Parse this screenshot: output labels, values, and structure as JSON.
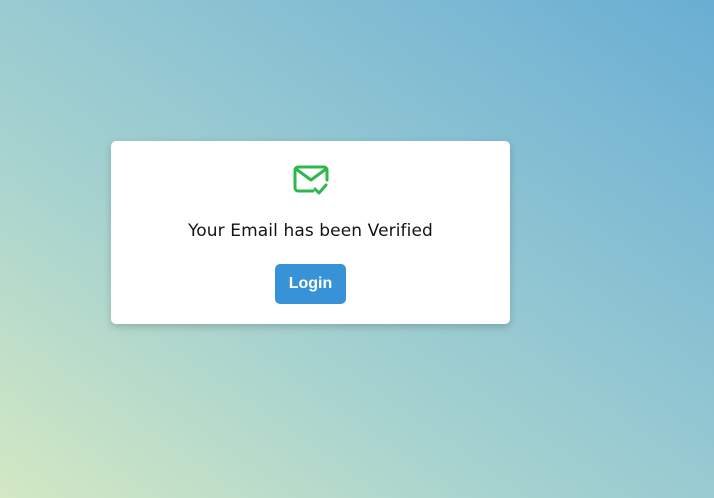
{
  "card": {
    "icon": "mail-check-icon",
    "icon_color": "#2db84c",
    "message": "Your Email has been Verified",
    "login_label": "Login",
    "button_color": "#3892d6"
  }
}
